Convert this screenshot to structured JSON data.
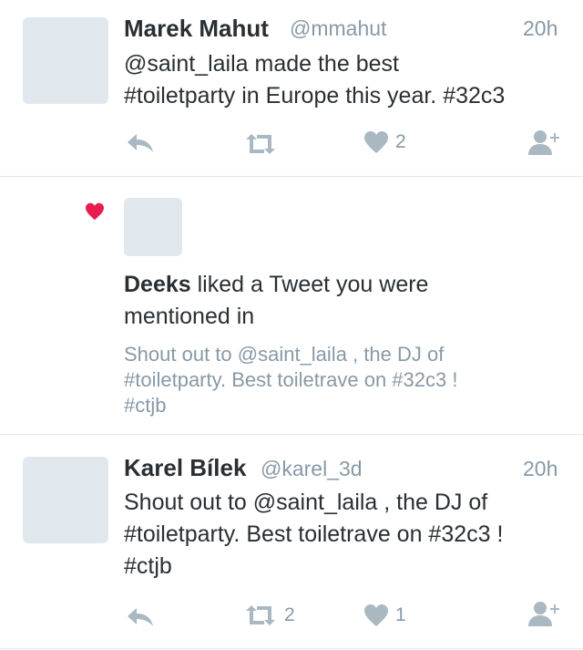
{
  "colors": {
    "icon_gray": "#aab8c2",
    "heart_red": "#e81c4f",
    "avatar_placeholder": "#e1e8ed",
    "divider": "#e1e8ed"
  },
  "tweet1": {
    "name": "Marek Mahut",
    "handle": "@mmahut",
    "time": "20h",
    "text_lines": [
      "@saint_laila made the best",
      "#toiletparty in Europe this year. #32c3"
    ],
    "like_count": "2"
  },
  "notification": {
    "icon": "heart-icon",
    "actor": "Deeks",
    "text_line1": " liked a Tweet you were",
    "text_line2": "mentioned in",
    "quoted_lines": [
      "Shout out to @saint_laila , the DJ of",
      "#toiletparty. Best toiletrave on #32c3 !",
      "#ctjb"
    ]
  },
  "tweet2": {
    "name": "Karel Bílek",
    "handle": "@karel_3d",
    "time": "20h",
    "text_lines": [
      "Shout out to @saint_laila , the DJ of",
      "#toiletparty. Best toiletrave on #32c3 !",
      "#ctjb"
    ],
    "retweet_count": "2",
    "like_count": "1"
  },
  "icons": [
    "reply-icon",
    "retweet-icon",
    "like-icon",
    "follow-icon"
  ]
}
